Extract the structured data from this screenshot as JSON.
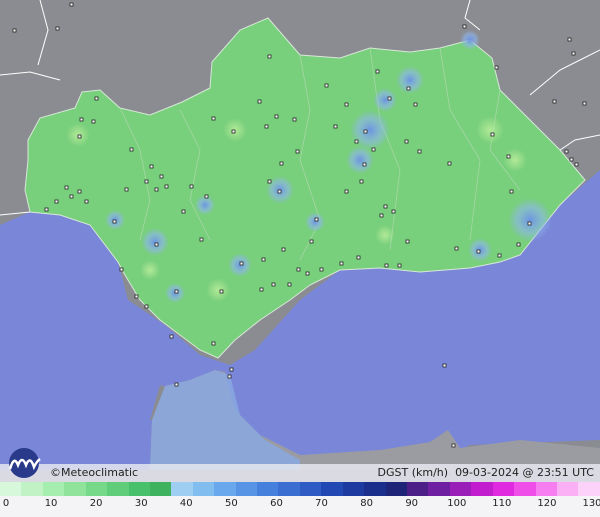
{
  "brand": {
    "symbol": "©",
    "name": "Meteoclimatic"
  },
  "variable": "DGST (km/h)",
  "timestamp": "09-03-2024 @ 23:51 UTC",
  "legend": {
    "ticks": [
      "0",
      "10",
      "20",
      "30",
      "40",
      "50",
      "60",
      "70",
      "80",
      "90",
      "100",
      "110",
      "120",
      "130"
    ],
    "colors": [
      "#d8f8dc",
      "#c0f2c6",
      "#a6eeb0",
      "#8fe39a",
      "#76d98a",
      "#5fcd7a",
      "#49c06c",
      "#3fb25f",
      "#9ecff2",
      "#82bdf0",
      "#6aa8ee",
      "#5794e6",
      "#4580dc",
      "#3a6ed0",
      "#2e5cc4",
      "#2248b4",
      "#1c3aa0",
      "#1a2e8c",
      "#1e2478",
      "#4b1e88",
      "#6e1ea0",
      "#9a1eb8",
      "#c21ed0",
      "#e02adf",
      "#f04ee8",
      "#f67ef0",
      "#fbb0f6",
      "#fcd2fa"
    ]
  }
}
